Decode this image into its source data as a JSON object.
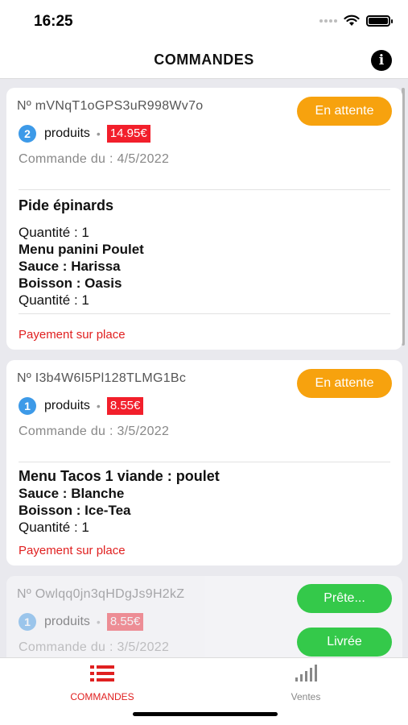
{
  "status_bar": {
    "time": "16:25"
  },
  "header": {
    "title": "COMMANDES",
    "info_icon": "info-icon"
  },
  "orders": [
    {
      "number": "Nº mVNqT1oGPS3uR998Wv7o",
      "product_count": "2",
      "products_label": "produits",
      "separator": "•",
      "price": "14.95€",
      "date": "Commande du : 4/5/2022",
      "status": "En attente",
      "items": [
        {
          "text": "Pide épinards",
          "style": "title"
        },
        {
          "text": "Quantité : 1",
          "style": "normal"
        },
        {
          "text": "Menu panini Poulet",
          "style": "bold"
        },
        {
          "text": "Sauce : Harissa",
          "style": "bold"
        },
        {
          "text": "Boisson : Oasis",
          "style": "bold"
        },
        {
          "text": "Quantité : 1",
          "style": "normal"
        }
      ],
      "payment": "Payement sur place"
    },
    {
      "number": "Nº I3b4W6I5Pl128TLMG1Bc",
      "product_count": "1",
      "products_label": "produits",
      "separator": "•",
      "price": "8.55€",
      "date": "Commande du : 3/5/2022",
      "status": "En attente",
      "items": [
        {
          "text": "Menu Tacos 1 viande : poulet",
          "style": "bold"
        },
        {
          "text": "Sauce : Blanche",
          "style": "bold"
        },
        {
          "text": "Boisson : Ice-Tea",
          "style": "bold"
        },
        {
          "text": "Quantité : 1",
          "style": "normal"
        }
      ],
      "payment": "Payement sur place"
    },
    {
      "number": "Nº Owlqq0jn3qHDgJs9H2kZ",
      "product_count": "1",
      "products_label": "produits",
      "separator": "•",
      "price": "8.55€",
      "date": "Commande du : 3/5/2022"
    }
  ],
  "action_buttons": {
    "ready": "Prête...",
    "delivered": "Livrée"
  },
  "tabs": [
    {
      "label": "COMMANDES",
      "icon": "list-icon",
      "active": true
    },
    {
      "label": "Ventes",
      "icon": "signal-bars-icon",
      "active": false
    }
  ],
  "colors": {
    "accent_red": "#e02020",
    "pending_orange": "#f7a20e",
    "action_green": "#34c94a",
    "badge_blue": "#3d9ae8",
    "price_red": "#f21f2b"
  }
}
